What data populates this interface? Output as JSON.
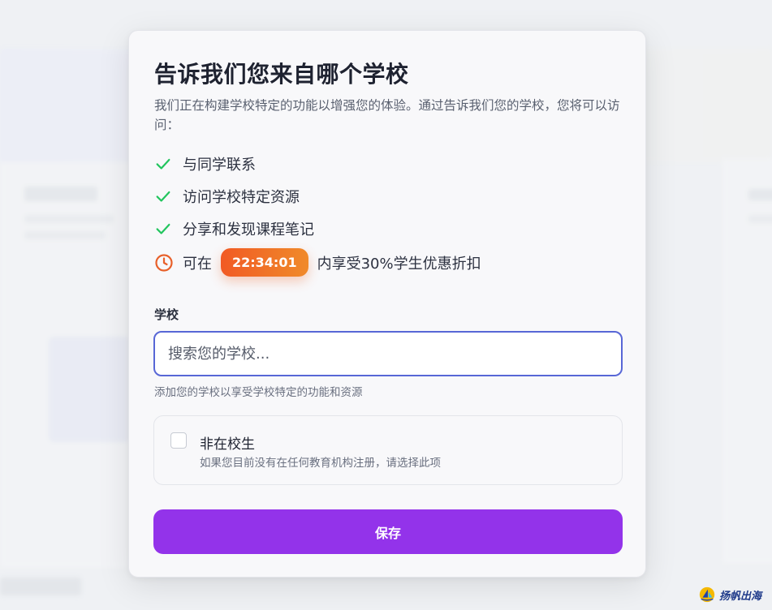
{
  "modal": {
    "title": "告诉我们您来自哪个学校",
    "description": "我们正在构建学校特定的功能以增强您的体验。通过告诉我们您的学校，您将可以访问：",
    "features": [
      {
        "label": "与同学联系",
        "icon": "check-icon"
      },
      {
        "label": "访问学校特定资源",
        "icon": "check-icon"
      },
      {
        "label": "分享和发现课程笔记",
        "icon": "check-icon"
      }
    ],
    "offer": {
      "prefix": "可在",
      "timer": "22:34:01",
      "suffix": "内享受30%学生优惠折扣",
      "icon": "clock-icon"
    },
    "school_field": {
      "label": "学校",
      "placeholder": "搜索您的学校...",
      "value": "",
      "helper": "添加您的学校以享受学校特定的功能和资源"
    },
    "non_student": {
      "checked": false,
      "title": "非在校生",
      "subtitle": "如果您目前没有在任何教育机构注册，请选择此项"
    },
    "save_label": "保存"
  },
  "watermark": {
    "text": "扬帆出海"
  },
  "colors": {
    "accent_purple": "#9333ea",
    "check_green": "#22c55e",
    "timer_orange": "#f15a24",
    "input_border": "#5867d6"
  }
}
